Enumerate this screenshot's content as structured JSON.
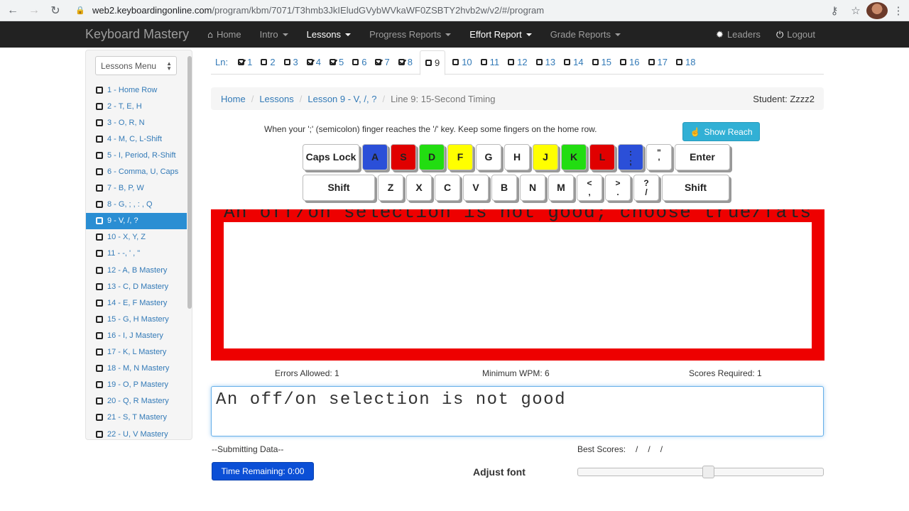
{
  "browser": {
    "url_domain": "web2.keyboardingonline.com",
    "url_path": "/program/kbm/7071/T3hmb3JkIEludGVybWVkaWF0ZSBTY2hvb2w/v2/#/program"
  },
  "navbar": {
    "brand": "Keyboard Mastery",
    "items": [
      {
        "label": "Home",
        "icon": "home-icon"
      },
      {
        "label": "Intro"
      },
      {
        "label": "Lessons"
      },
      {
        "label": "Progress Reports"
      },
      {
        "label": "Effort Report"
      },
      {
        "label": "Grade Reports"
      }
    ],
    "leaders": "Leaders",
    "logout": "Logout"
  },
  "sidebar": {
    "select_label": "Lessons Menu",
    "lessons": [
      "1 - Home Row",
      "2 - T, E, H",
      "3 - O, R, N",
      "4 - M, C, L-Shift",
      "5 - I, Period, R-Shift",
      "6 - Comma, U, Caps",
      "7 - B, P, W",
      "8 - G, ; , : , Q",
      "9 - V, /, ?",
      "10 - X, Y, Z",
      "11 - -, ' , \"",
      "12 - A, B Mastery",
      "13 - C, D Mastery",
      "14 - E, F Mastery",
      "15 - G, H Mastery",
      "16 - I, J Mastery",
      "17 - K, L Mastery",
      "18 - M, N Mastery",
      "19 - O, P Mastery",
      "20 - Q, R Mastery",
      "21 - S, T Mastery",
      "22 - U, V Mastery"
    ],
    "active_index": 8
  },
  "line_tabs": {
    "label": "Ln:",
    "tabs": [
      {
        "num": "1",
        "checked": true
      },
      {
        "num": "2",
        "checked": false
      },
      {
        "num": "3",
        "checked": false
      },
      {
        "num": "4",
        "checked": true
      },
      {
        "num": "5",
        "checked": true
      },
      {
        "num": "6",
        "checked": false
      },
      {
        "num": "7",
        "checked": true
      },
      {
        "num": "8",
        "checked": true
      },
      {
        "num": "9",
        "checked": false,
        "active": true
      },
      {
        "num": "10",
        "checked": false
      },
      {
        "num": "11",
        "checked": false
      },
      {
        "num": "12",
        "checked": false
      },
      {
        "num": "13",
        "checked": false
      },
      {
        "num": "14",
        "checked": false
      },
      {
        "num": "15",
        "checked": false
      },
      {
        "num": "16",
        "checked": false
      },
      {
        "num": "17",
        "checked": false
      },
      {
        "num": "18",
        "checked": false
      }
    ]
  },
  "breadcrumb": {
    "home": "Home",
    "lessons": "Lessons",
    "lesson": "Lesson 9 - V, /, ?",
    "current": "Line 9: 15-Second Timing",
    "student": "Student: Zzzz2"
  },
  "instruction": "When your ';' (semicolon) finger reaches the '/' key. Keep some fingers on the home row.",
  "show_reach": "Show Reach",
  "keyboard": {
    "row1": [
      {
        "label": "Caps Lock",
        "color": "#ffffff"
      },
      {
        "label": "A",
        "color": "#2b4fd8"
      },
      {
        "label": "S",
        "color": "#e00000"
      },
      {
        "label": "D",
        "color": "#22dd11"
      },
      {
        "label": "F",
        "color": "#ffff00"
      },
      {
        "label": "G",
        "color": "#ffffff"
      },
      {
        "label": "H",
        "color": "#ffffff"
      },
      {
        "label": "J",
        "color": "#ffff00"
      },
      {
        "label": "K",
        "color": "#22dd11"
      },
      {
        "label": "L",
        "color": "#e00000"
      },
      {
        "label": ":",
        "label2": ";",
        "color": "#2b4fd8"
      },
      {
        "label": "\"",
        "label2": "'",
        "color": "#ffffff"
      },
      {
        "label": "Enter",
        "color": "#ffffff"
      }
    ],
    "row2": [
      {
        "label": "Shift"
      },
      {
        "label": "Z"
      },
      {
        "label": "X"
      },
      {
        "label": "C"
      },
      {
        "label": "V"
      },
      {
        "label": "B"
      },
      {
        "label": "N"
      },
      {
        "label": "M"
      },
      {
        "label": "<",
        "label2": ","
      },
      {
        "label": ">",
        "label2": "."
      },
      {
        "label": "?",
        "label2": "/"
      },
      {
        "label": "Shift"
      }
    ]
  },
  "display_text": "An off/on selection is not good; choose true/false.↵",
  "border_color": "#ee0000",
  "stats": {
    "errors": "Errors Allowed: 1",
    "wpm": "Minimum WPM: 6",
    "scores": "Scores Required: 1"
  },
  "typed_text": "An off/on selection is not good",
  "submitting": "--Submitting Data--",
  "best_scores": {
    "label": "Best Scores:",
    "values": [
      "/",
      "/",
      "/"
    ]
  },
  "time_remaining": "Time Remaining: 0:00",
  "adjust_font": "Adjust font",
  "font_slider_fraction": 0.53
}
